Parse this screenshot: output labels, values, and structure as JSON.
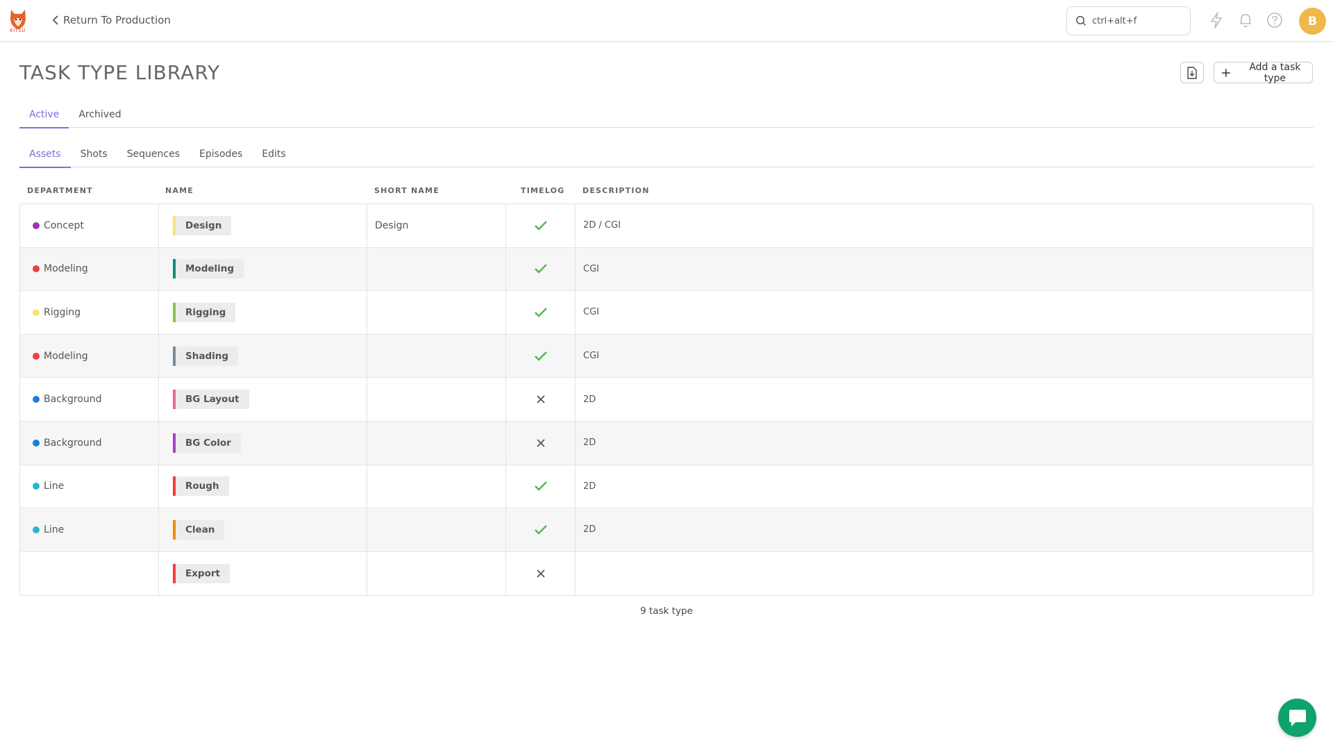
{
  "app": {
    "logo_text": "KITSU"
  },
  "header": {
    "back_label": "Return To Production",
    "search_placeholder": "ctrl+alt+f",
    "avatar_initial": "B",
    "icons": [
      "lightning-icon",
      "bell-icon",
      "help-icon"
    ]
  },
  "page": {
    "title": "TASK TYPE LIBRARY",
    "add_label": "Add a task type",
    "export_icon": "import-file-icon"
  },
  "tabs": {
    "primary": [
      {
        "label": "Active",
        "active": true
      },
      {
        "label": "Archived",
        "active": false
      }
    ],
    "secondary": [
      {
        "label": "Assets",
        "active": true
      },
      {
        "label": "Shots",
        "active": false
      },
      {
        "label": "Sequences",
        "active": false
      },
      {
        "label": "Episodes",
        "active": false
      },
      {
        "label": "Edits",
        "active": false
      }
    ]
  },
  "table": {
    "headers": {
      "department": "DEPARTMENT",
      "name": "NAME",
      "short_name": "SHORT NAME",
      "timelog": "TIMELOG",
      "description": "DESCRIPTION"
    },
    "rows": [
      {
        "department": "Concept",
        "dept_color": "#9c36b5",
        "name": "Design",
        "name_color": "#f5e37a",
        "short_name": "Design",
        "timelog": true,
        "description": "2D / CGI"
      },
      {
        "department": "Modeling",
        "dept_color": "#f03e3e",
        "name": "Modeling",
        "name_color": "#0c8f7a",
        "short_name": "",
        "timelog": true,
        "description": "CGI"
      },
      {
        "department": "Rigging",
        "dept_color": "#f7e56b",
        "name": "Rigging",
        "name_color": "#8bc34a",
        "short_name": "",
        "timelog": true,
        "description": "CGI"
      },
      {
        "department": "Modeling",
        "dept_color": "#f03e3e",
        "name": "Shading",
        "name_color": "#7a8a99",
        "short_name": "",
        "timelog": true,
        "description": "CGI"
      },
      {
        "department": "Background",
        "dept_color": "#1c7ed6",
        "name": "BG Layout",
        "name_color": "#f06595",
        "short_name": "",
        "timelog": false,
        "description": "2D"
      },
      {
        "department": "Background",
        "dept_color": "#1c7ed6",
        "name": "BG Color",
        "name_color": "#ae3ec9",
        "short_name": "",
        "timelog": false,
        "description": "2D"
      },
      {
        "department": "Line",
        "dept_color": "#22b8cf",
        "name": "Rough",
        "name_color": "#f03e3e",
        "short_name": "",
        "timelog": true,
        "description": "2D"
      },
      {
        "department": "Line",
        "dept_color": "#22b8cf",
        "name": "Clean",
        "name_color": "#f08c00",
        "short_name": "",
        "timelog": true,
        "description": "2D"
      },
      {
        "department": "",
        "dept_color": "",
        "name": "Export",
        "name_color": "#f03e3e",
        "short_name": "",
        "timelog": false,
        "description": ""
      }
    ]
  },
  "footer": {
    "count_label": "9 task type"
  },
  "colors": {
    "accent": "#7a6fd8",
    "check": "#51b849",
    "cross": "#555555",
    "chat": "#0fa36a",
    "avatar": "#f0b74a"
  }
}
